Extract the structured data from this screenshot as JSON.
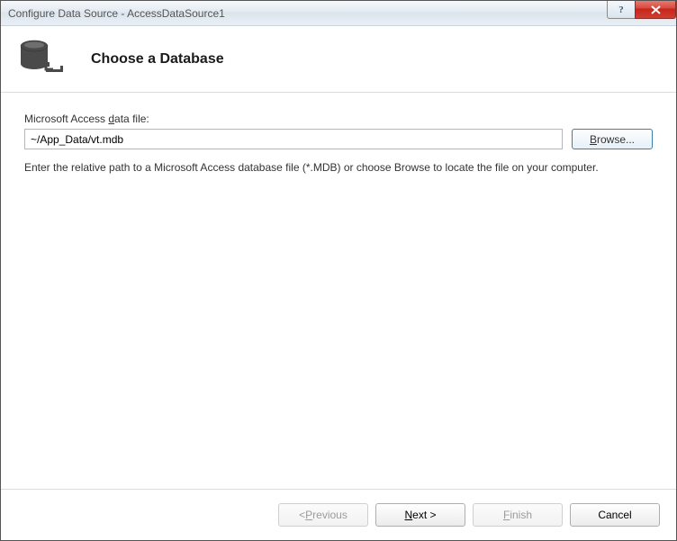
{
  "window": {
    "title": "Configure Data Source - AccessDataSource1"
  },
  "header": {
    "page_title": "Choose a Database"
  },
  "form": {
    "label_pre": "Microsoft Access ",
    "label_ul": "d",
    "label_post": "ata file:",
    "path_value": "~/App_Data/vt.mdb",
    "browse_ul": "B",
    "browse_post": "rowse...",
    "help_text": "Enter the relative path to a Microsoft Access database file (*.MDB) or choose Browse to locate the file on your computer."
  },
  "footer": {
    "previous_pre": "< ",
    "previous_ul": "P",
    "previous_post": "revious",
    "next_ul": "N",
    "next_post": "ext >",
    "finish_ul": "F",
    "finish_post": "inish",
    "cancel": "Cancel"
  }
}
